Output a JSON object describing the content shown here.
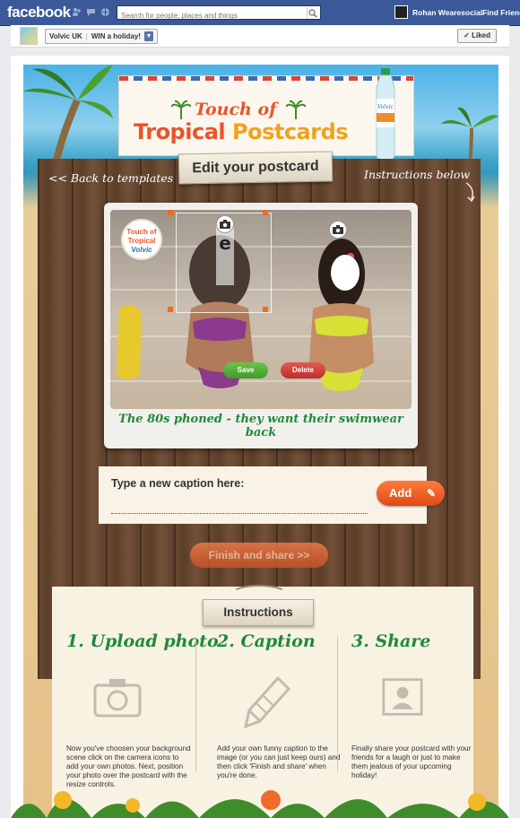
{
  "facebook": {
    "logo": "facebook",
    "search_placeholder": "Search for people, places and things",
    "user_name": "Rohan Wearesocial",
    "find_friends": "Find Friends",
    "icons": [
      "friend-requests-icon",
      "messages-icon",
      "notifications-icon",
      "search-icon"
    ]
  },
  "page": {
    "name": "Volvic UK",
    "tab": "WIN a holiday!",
    "liked_label": "Liked",
    "liked_icon": "checkmark-icon"
  },
  "app": {
    "banner": {
      "line1": "Touch of",
      "line2a": "Tropical",
      "line2b": "Postcards"
    },
    "edit_title": "Edit your postcard",
    "back_link": "<< Back to templates",
    "instructions_link": "Instructions below",
    "postcard": {
      "logo_text": [
        "Touch of",
        "Tropical",
        "Volvic"
      ],
      "caption": "The 80s phoned - they want their swimwear back",
      "save_label": "Save",
      "delete_label": "Delete"
    },
    "caption_box": {
      "label": "Type a new caption here:",
      "value": "",
      "add_label": "Add"
    },
    "finish_label": "Finish and share >>",
    "instructions": {
      "title": "Instructions",
      "steps": [
        {
          "title": "1. Upload photo",
          "icon": "camera-icon",
          "text": "Now you've choosen your background scene click on the camera icons to add your own photos. Next, position your photo over the postcard with the resize controls."
        },
        {
          "title": "2. Caption",
          "icon": "pencil-icon",
          "text": "Add your own funny caption to the image (or you can just keep ours) and then click 'Finish and share' when you're done."
        },
        {
          "title": "3. Share",
          "icon": "postcard-icon",
          "text": "Finally share your postcard with your friends for a laugh or just to make them jealous of your upcoming holiday!"
        }
      ]
    }
  },
  "colors": {
    "fb_blue": "#3b5998",
    "brand_orange": "#e8552a",
    "caption_green": "#1f8a3a",
    "save_green": "#4fa83a",
    "delete_red": "#c9403a"
  }
}
